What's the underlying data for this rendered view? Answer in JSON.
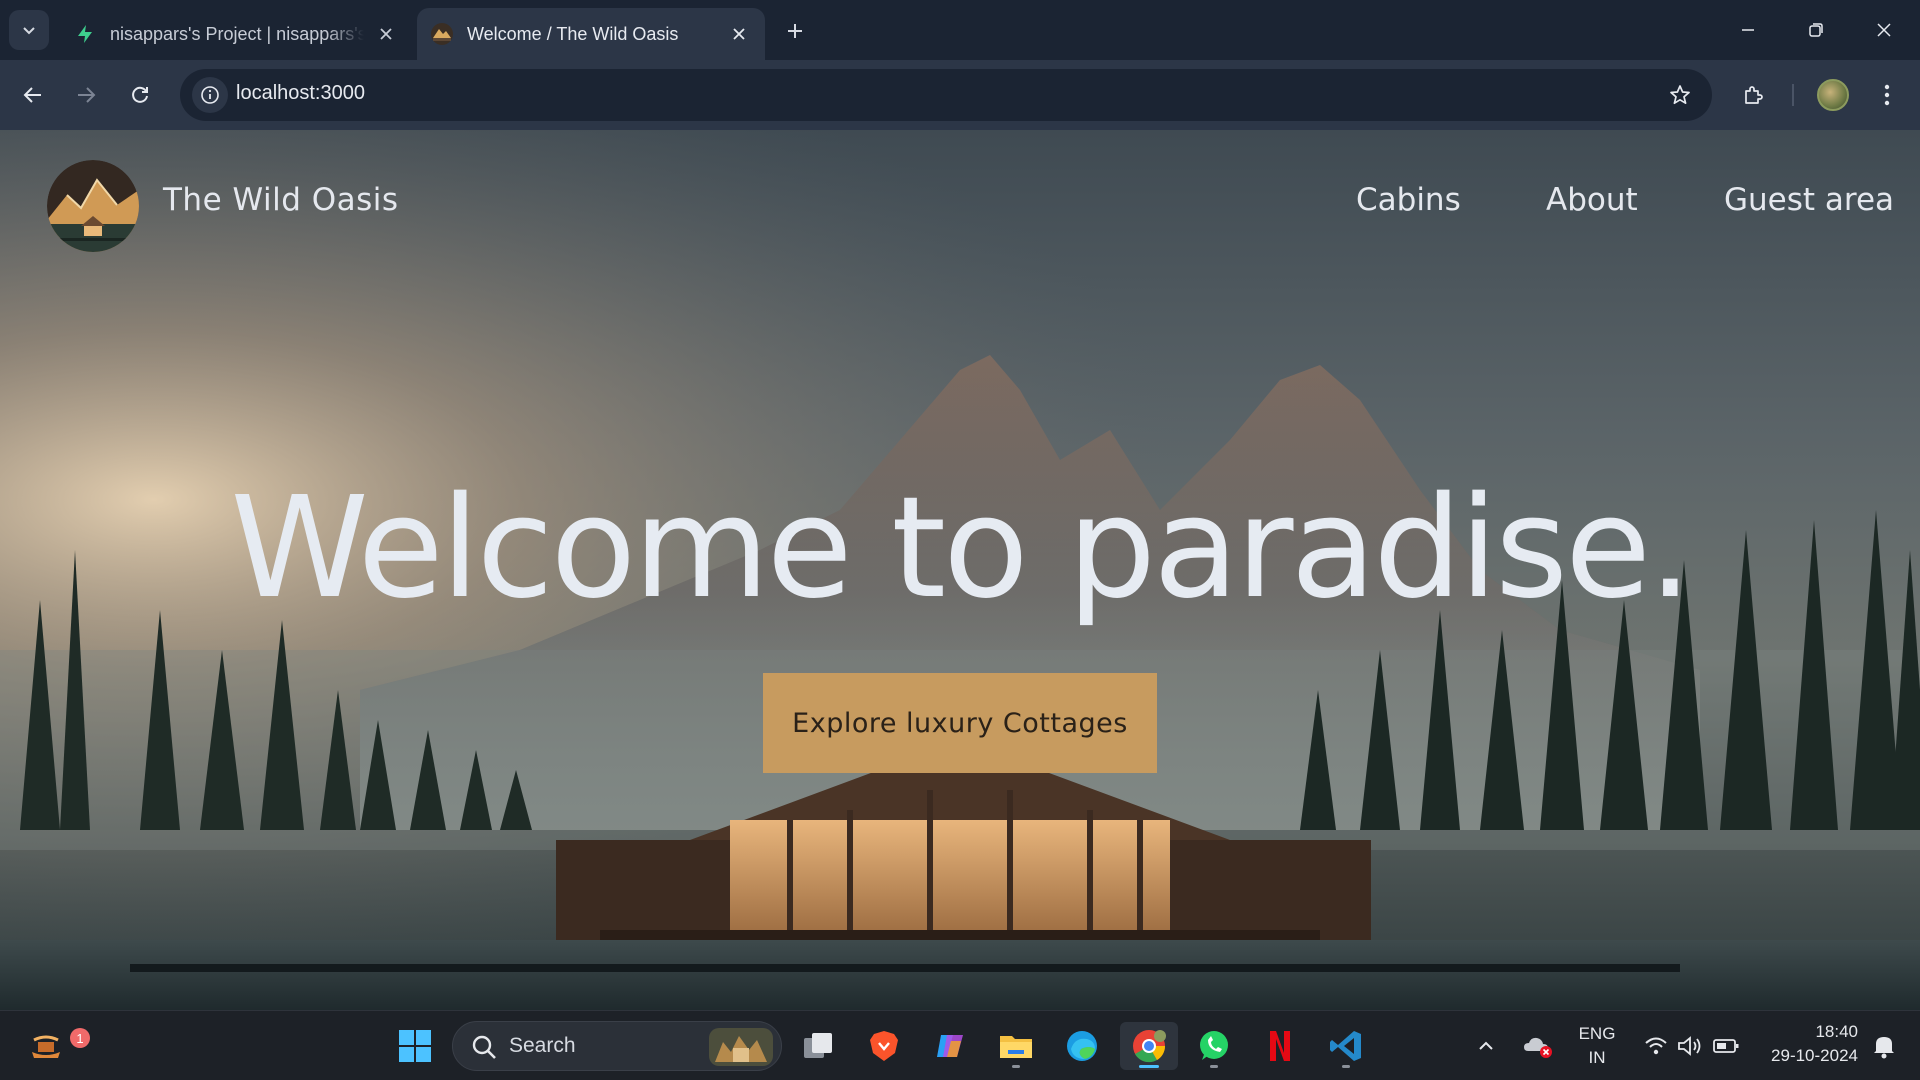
{
  "browser": {
    "tabs": [
      {
        "title": "nisappars's Project | nisappars's",
        "active": false
      },
      {
        "title": "Welcome / The Wild Oasis",
        "active": true
      }
    ],
    "url": "localhost:3000"
  },
  "site": {
    "brand": "The Wild Oasis",
    "nav": [
      "Cabins",
      "About",
      "Guest area"
    ],
    "hero_title": "Welcome to paradise.",
    "cta_label": "Explore luxury Cottages",
    "colors": {
      "accent": "#c79b5f",
      "text": "#e6ebf2",
      "chrome_bg": "#1b2433"
    }
  },
  "taskbar": {
    "search_placeholder": "Search",
    "notification_count": "1",
    "language": "ENG",
    "region": "IN",
    "time": "18:40",
    "date": "29-10-2024",
    "pinned": [
      "start-icon",
      "task-view-icon",
      "brave-icon",
      "copilot-icon",
      "file-explorer-icon",
      "edge-icon",
      "chrome-icon",
      "whatsapp-icon",
      "netflix-icon",
      "vscode-icon"
    ]
  }
}
